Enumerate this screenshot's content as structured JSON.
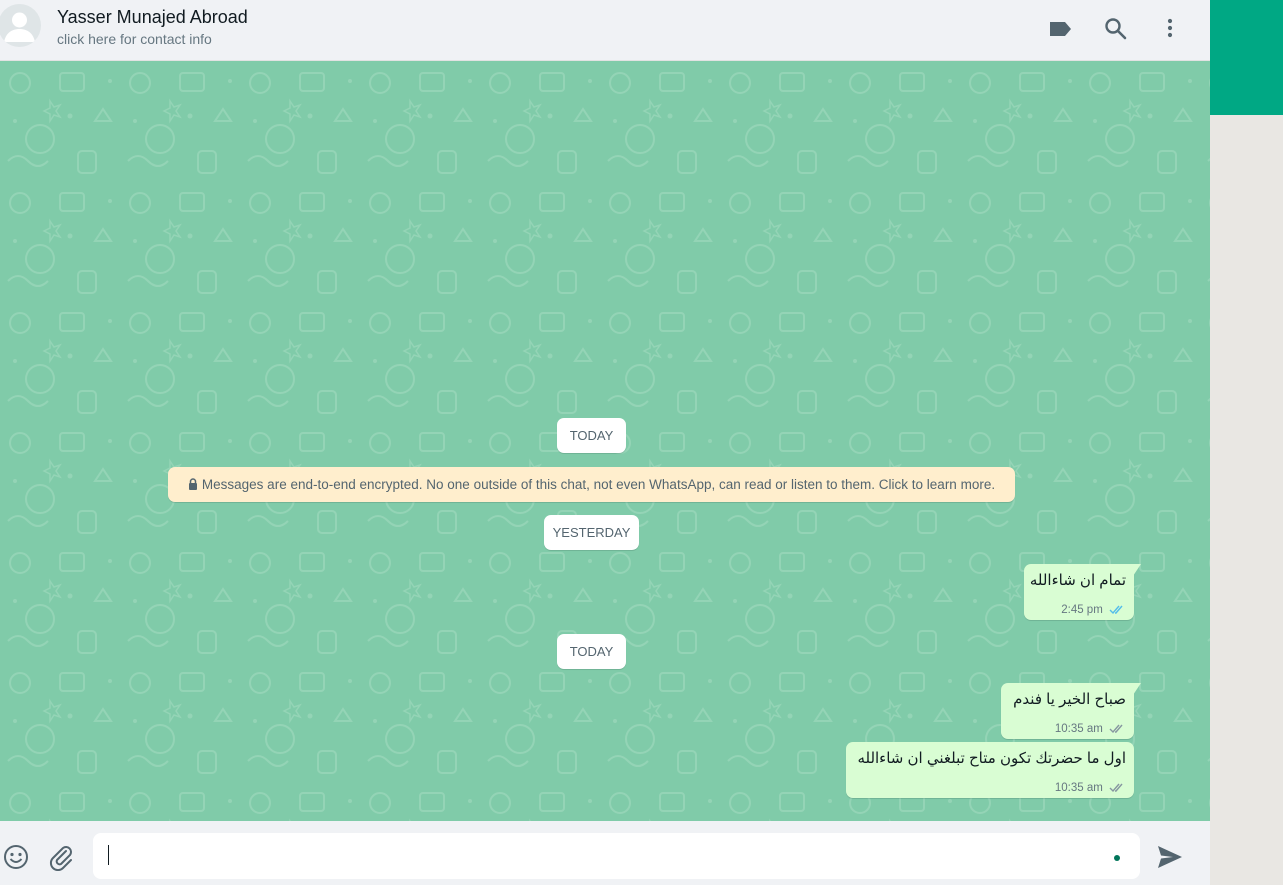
{
  "header": {
    "contact_name": "Yasser Munajed Abroad",
    "contact_subtitle": "click here for contact info",
    "icons": [
      "label-icon",
      "search-icon",
      "menu-icon"
    ]
  },
  "conversation": {
    "date_today_1": "TODAY",
    "encryption_notice": "Messages are end-to-end encrypted. No one outside of this chat, not even WhatsApp, can read or listen to them. Click to learn more.",
    "date_yesterday": "YESTERDAY",
    "date_today_2": "TODAY",
    "messages": [
      {
        "text": "تمام ان شاءالله",
        "time": "2:45 pm",
        "status": "read"
      },
      {
        "text": "صباح الخير يا فندم",
        "time": "10:35 am",
        "status": "delivered"
      },
      {
        "text": "اول ما حضرتك تكون متاح تبلغني ان شاءالله",
        "time": "10:35 am",
        "status": "delivered"
      }
    ]
  },
  "composer": {
    "value": "",
    "icons": [
      "emoji-icon",
      "attach-icon",
      "send-icon"
    ]
  },
  "colors": {
    "wallpaper": "#80cba9",
    "outgoing_bubble": "#d9fdd3",
    "accent": "#00a884",
    "encryption_bg": "#ffeecd",
    "read_ticks": "#53bdeb"
  }
}
